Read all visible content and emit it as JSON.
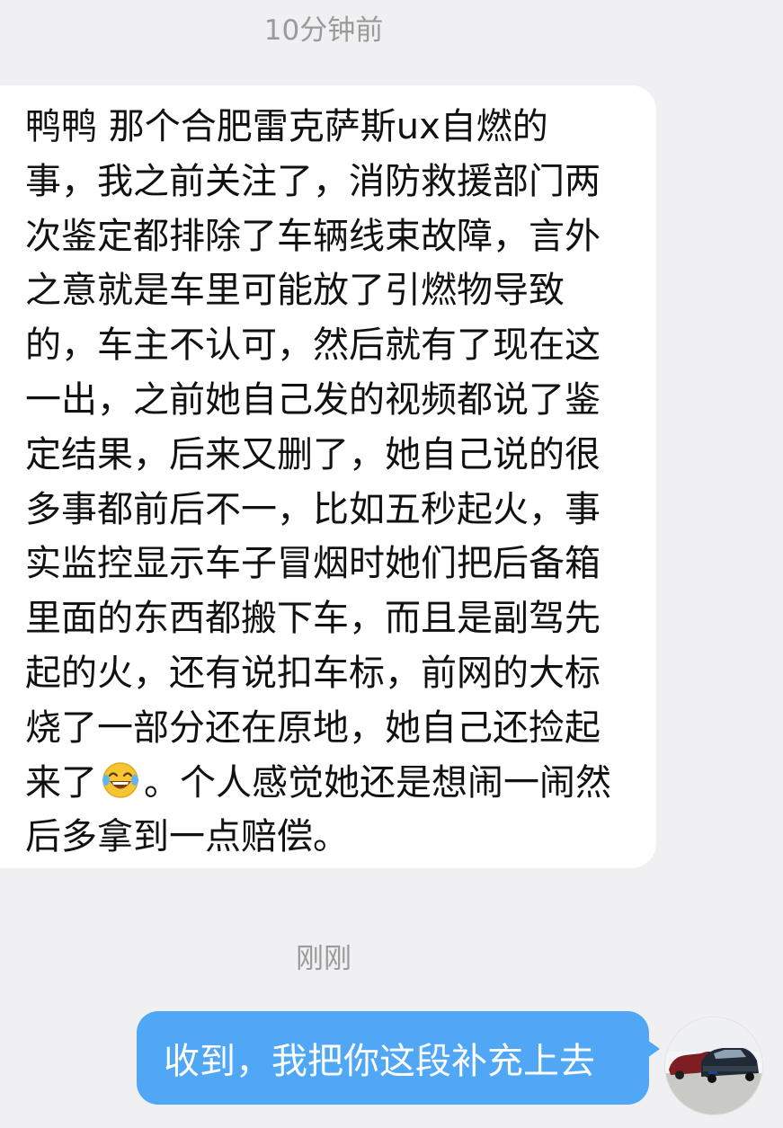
{
  "chat": {
    "messages": [
      {
        "timestamp": "10分钟前",
        "direction": "incoming",
        "text_before_emoji": "鸭鸭 那个合肥雷克萨斯ux自燃的事，我之前关注了，消防救援部门两次鉴定都排除了车辆线束故障，言外之意就是车里可能放了引燃物导致的，车主不认可，然后就有了现在这一出，之前她自己发的视频都说了鉴定结果，后来又删了，她自己说的很多事都前后不一，比如五秒起火，事实监控显示车子冒烟时她们把后备箱里面的东西都搬下车，而且是副驾先起的火，还有说扣车标，前网的大标烧了一部分还在原地，她自己还捡起来了",
        "emoji": "face-with-tears-of-joy-icon",
        "text_after_emoji": "。个人感觉她还是想闹一闹然后多拿到一点赔偿。"
      },
      {
        "timestamp": "刚刚",
        "direction": "outgoing",
        "text": "收到，我把你这段补充上去",
        "avatar": "avatar-cars-photo"
      }
    ]
  },
  "colors": {
    "background": "#f0f0f2",
    "incoming_bubble": "#ffffff",
    "outgoing_bubble": "#4fa7f6",
    "timestamp_text": "#9a9a9a"
  }
}
